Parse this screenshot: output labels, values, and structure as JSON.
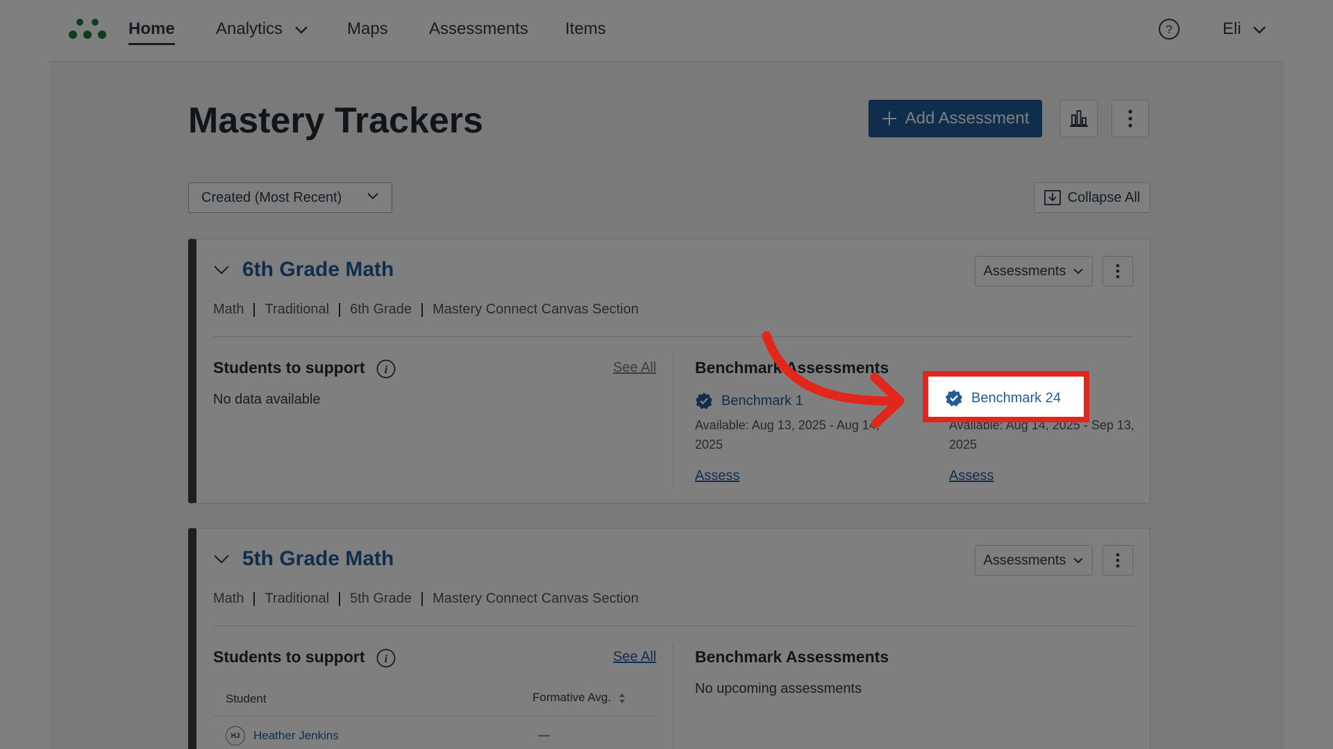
{
  "nav": {
    "items": [
      {
        "label": "Home",
        "active": true
      },
      {
        "label": "Analytics",
        "has_dropdown": true
      },
      {
        "label": "Maps"
      },
      {
        "label": "Assessments"
      },
      {
        "label": "Items"
      }
    ],
    "user_label": "Eli"
  },
  "header": {
    "title": "Mastery Trackers",
    "add_button": "Add Assessment"
  },
  "toolbar": {
    "sort_value": "Created (Most Recent)",
    "collapse_label": "Collapse All"
  },
  "cards": [
    {
      "title": "6th Grade Math",
      "meta": [
        "Math",
        "Traditional",
        "6th Grade",
        "Mastery Connect Canvas Section"
      ],
      "assessments_label": "Assessments",
      "students_heading": "Students to support",
      "see_all": "See All",
      "no_data": "No data available",
      "benchmarks_heading": "Benchmark Assessments",
      "benchmarks": [
        {
          "name": "Benchmark 1",
          "available": "Available: Aug 13, 2025 - Aug 14, 2025",
          "action": "Assess"
        },
        {
          "name": "Benchmark 24",
          "available": "Available: Aug 14, 2025 - Sep 13, 2025",
          "action": "Assess"
        }
      ]
    },
    {
      "title": "5th Grade Math",
      "meta": [
        "Math",
        "Traditional",
        "5th Grade",
        "Mastery Connect Canvas Section"
      ],
      "assessments_label": "Assessments",
      "students_heading": "Students to support",
      "see_all": "See All",
      "table_headers": {
        "student": "Student",
        "formative_avg": "Formative Avg."
      },
      "students": [
        {
          "initials": "HJ",
          "name": "Heather Jenkins",
          "avg": "—"
        }
      ],
      "benchmarks_heading": "Benchmark Assessments",
      "no_upcoming": "No upcoming assessments"
    }
  ],
  "colors": {
    "accent": "#1f5d9a",
    "highlight": "#e2261c",
    "card_border": "#3a4147"
  }
}
